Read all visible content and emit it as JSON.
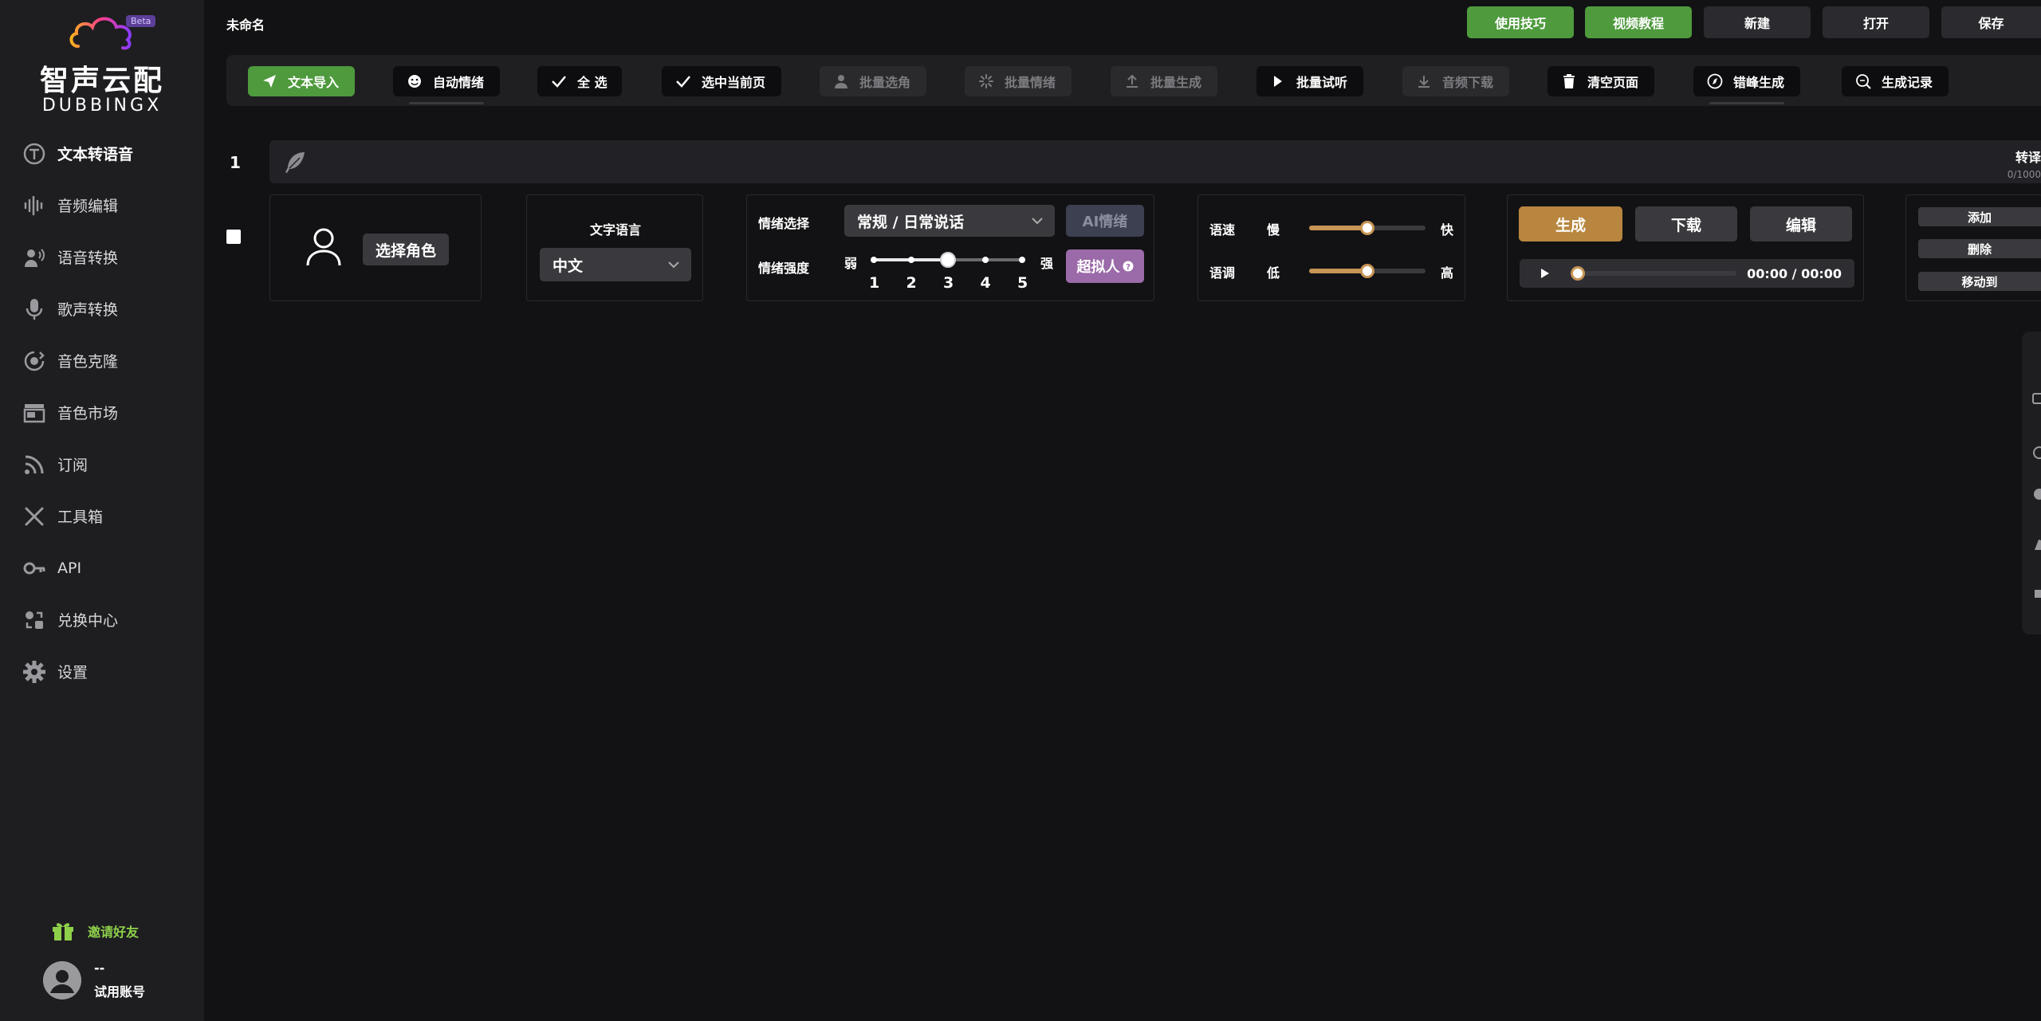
{
  "project": {
    "title": "未命名"
  },
  "logo": {
    "beta": "Beta",
    "name_cn": "智声云配",
    "name_en": "DUBBINGX"
  },
  "sidebar": {
    "items": [
      {
        "label": "文本转语音",
        "icon": "tts-icon",
        "active": true
      },
      {
        "label": "音频编辑",
        "icon": "waveform-icon"
      },
      {
        "label": "语音转换",
        "icon": "voice-convert-icon"
      },
      {
        "label": "歌声转换",
        "icon": "microphone-icon"
      },
      {
        "label": "音色克隆",
        "icon": "voice-clone-icon"
      },
      {
        "label": "音色市场",
        "icon": "store-icon"
      },
      {
        "label": "订阅",
        "icon": "rss-icon"
      },
      {
        "label": "工具箱",
        "icon": "tools-icon"
      },
      {
        "label": "API",
        "icon": "key-icon"
      },
      {
        "label": "兑换中心",
        "icon": "exchange-icon"
      },
      {
        "label": "设置",
        "icon": "gear-icon"
      }
    ],
    "invite": "邀请好友",
    "account": {
      "name": "--",
      "type": "试用账号"
    }
  },
  "topbar": {
    "tips": "使用技巧",
    "tutorial": "视频教程",
    "new": "新建",
    "open": "打开",
    "save": "保存"
  },
  "toolbar": {
    "import": "文本导入",
    "auto_emotion": "自动情绪",
    "select_all": "全 选",
    "select_page": "选中当前页",
    "batch_role": "批量选角",
    "batch_emotion": "批量情绪",
    "batch_generate": "批量生成",
    "batch_preview": "批量试听",
    "audio_download": "音频下载",
    "clear_page": "清空页面",
    "staggered_generate": "错峰生成",
    "history": "生成记录"
  },
  "row": {
    "index": "1",
    "translate": "转译",
    "char_count": "0/1000",
    "select_role": "选择角色",
    "text_lang_label": "文字语言",
    "text_lang_value": "中文",
    "emotion_select_label": "情绪选择",
    "emotion_value": "常规 / 日常说话",
    "ai_emotion": "AI情绪",
    "emotion_strength_label": "情绪强度",
    "weak": "弱",
    "strong": "强",
    "strength_ticks": [
      "1",
      "2",
      "3",
      "4",
      "5"
    ],
    "strength_value": 3,
    "super_human": "超拟人",
    "speed_label": "语速",
    "slow": "慢",
    "fast": "快",
    "speed_value": 0.5,
    "pitch_label": "语调",
    "low": "低",
    "high": "高",
    "pitch_value": 0.5,
    "generate": "生成",
    "download": "下载",
    "edit": "编辑",
    "time": "00:00 / 00:00",
    "add": "添加",
    "delete": "删除",
    "move_to": "移动到"
  },
  "colors": {
    "accent_gold": "#c79554",
    "green": "#4e9a3d",
    "purple": "#9b6aa8",
    "invite_green": "#8ed04a"
  }
}
